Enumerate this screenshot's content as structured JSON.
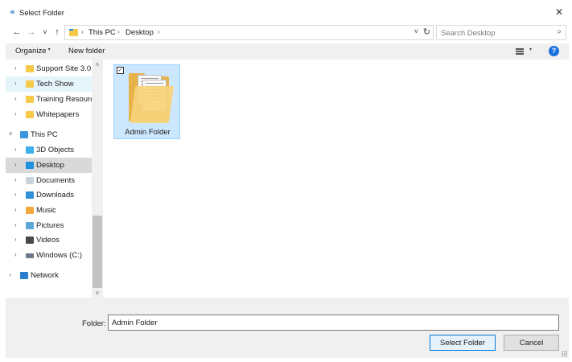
{
  "window": {
    "title": "Select Folder",
    "close_glyph": "✕"
  },
  "nav": {
    "back_glyph": "←",
    "forward_glyph": "→",
    "recent_glyph": "˅",
    "up_glyph": "↑",
    "breadcrumb": [
      "This PC",
      "Desktop"
    ],
    "crumb_separator": "›",
    "address_dropdown_glyph": "˅",
    "refresh_glyph": "↻"
  },
  "search": {
    "placeholder": "Search Desktop",
    "icon_glyph": "⌕"
  },
  "toolbar": {
    "organize_label": "Organize",
    "organize_caret": "▾",
    "new_folder_label": "New folder",
    "view_caret": "▾",
    "help_glyph": "?"
  },
  "sidebar": {
    "items": [
      {
        "label": "Support Site 3.0",
        "chevron": "›",
        "icon": "folder-icon",
        "color": "#f7c948",
        "state": ""
      },
      {
        "label": "Tech Show",
        "chevron": "›",
        "icon": "folder-icon",
        "color": "#f7c948",
        "state": "hover"
      },
      {
        "label": "Training Resources",
        "chevron": "›",
        "icon": "folder-icon",
        "color": "#f7c948",
        "state": ""
      },
      {
        "label": "Whitepapers",
        "chevron": "›",
        "icon": "folder-icon",
        "color": "#f7c948",
        "state": ""
      },
      {
        "label": "This PC",
        "chevron": "˅",
        "icon": "computer-icon",
        "color": "#3a96dd",
        "state": ""
      },
      {
        "label": "3D Objects",
        "chevron": "›",
        "icon": "3d-objects-icon",
        "color": "#3ab0e8",
        "state": ""
      },
      {
        "label": "Desktop",
        "chevron": "›",
        "icon": "desktop-folder-icon",
        "color": "#1e90e0",
        "state": "selected"
      },
      {
        "label": "Documents",
        "chevron": "›",
        "icon": "documents-icon",
        "color": "#c8d3de",
        "state": ""
      },
      {
        "label": "Downloads",
        "chevron": "›",
        "icon": "downloads-icon",
        "color": "#2f8fd8",
        "state": ""
      },
      {
        "label": "Music",
        "chevron": "›",
        "icon": "music-icon",
        "color": "#f2a83a",
        "state": ""
      },
      {
        "label": "Pictures",
        "chevron": "›",
        "icon": "pictures-icon",
        "color": "#5ea6d8",
        "state": ""
      },
      {
        "label": "Videos",
        "chevron": "›",
        "icon": "videos-icon",
        "color": "#4a4a4a",
        "state": ""
      },
      {
        "label": "Windows (C:)",
        "chevron": "›",
        "icon": "drive-icon",
        "color": "#6a7a8a",
        "state": ""
      },
      {
        "label": "Network",
        "chevron": "›",
        "icon": "network-icon",
        "color": "#2b7fd0",
        "state": ""
      }
    ],
    "scroll_up_glyph": "˄",
    "scroll_down_glyph": "˅"
  },
  "content": {
    "items": [
      {
        "name": "Admin Folder",
        "checked": true,
        "check_glyph": "✓"
      }
    ]
  },
  "bottom": {
    "folder_label": "Folder:",
    "folder_value": "Admin Folder",
    "select_button": "Select Folder",
    "cancel_button": "Cancel"
  },
  "colors": {
    "accent": "#0078d7",
    "selection": "#cce8ff",
    "selection_border": "#99d1ff"
  }
}
